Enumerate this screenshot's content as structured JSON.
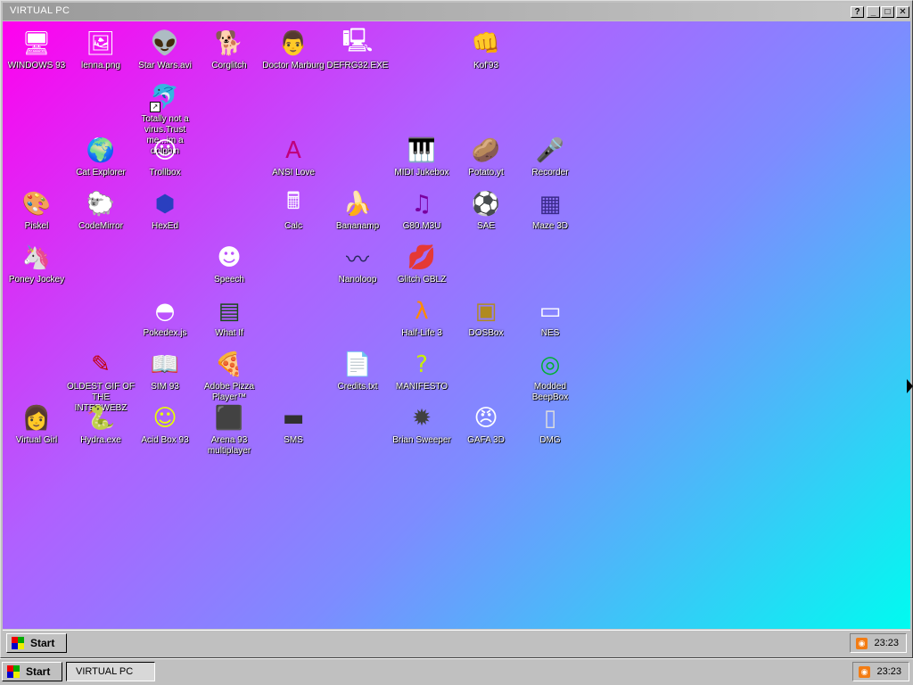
{
  "window": {
    "title": "VIRTUAL PC",
    "help_label": "?",
    "minimize_label": "_",
    "maximize_label": "□",
    "close_label": "✕"
  },
  "desktop": {
    "icons": [
      {
        "label": "WINDOWS 93",
        "icon": "computer-icon",
        "col": 0,
        "row": 0
      },
      {
        "label": "lenna.png",
        "icon": "image-file-icon",
        "col": 1,
        "row": 0
      },
      {
        "label": "Star Wars.avi",
        "icon": "yoda-icon",
        "col": 2,
        "row": 0
      },
      {
        "label": "Corglitch",
        "icon": "corgi-icon",
        "col": 3,
        "row": 0
      },
      {
        "label": "Doctor Marburg",
        "icon": "doctor-icon",
        "col": 4,
        "row": 0
      },
      {
        "label": "DEFRG32.EXE",
        "icon": "monitor-face-icon",
        "col": 5,
        "row": 0
      },
      {
        "label": "Kof'93",
        "icon": "fighter-icon",
        "col": 7,
        "row": 0
      },
      {
        "label": "Totally not a virus.Trust me...im a dolphin",
        "icon": "dolphin-icon",
        "col": 2,
        "row": 1,
        "shortcut": true
      },
      {
        "label": "Cat Explorer",
        "icon": "globe-cat-icon",
        "col": 1,
        "row": 2
      },
      {
        "label": "Trollbox",
        "icon": "trollbox-icon",
        "col": 2,
        "row": 2
      },
      {
        "label": "ANSI Love",
        "icon": "ansi-file-icon",
        "col": 4,
        "row": 2
      },
      {
        "label": "MIDI Jukebox",
        "icon": "piano-icon",
        "col": 6,
        "row": 2
      },
      {
        "label": "Potato.yt",
        "icon": "potato-icon",
        "col": 7,
        "row": 2
      },
      {
        "label": "Recorder",
        "icon": "microphone-icon",
        "col": 8,
        "row": 2
      },
      {
        "label": "Piskel",
        "icon": "palette-icon",
        "col": 0,
        "row": 3
      },
      {
        "label": "CodeMirror",
        "icon": "codemirror-icon",
        "col": 1,
        "row": 3
      },
      {
        "label": "HexEd",
        "icon": "hexagon-icon",
        "col": 2,
        "row": 3
      },
      {
        "label": "Calc",
        "icon": "calculator-icon",
        "col": 4,
        "row": 3
      },
      {
        "label": "Bananamp",
        "icon": "banana-icon",
        "col": 5,
        "row": 3
      },
      {
        "label": "G80.M3U",
        "icon": "audio-file-icon",
        "col": 6,
        "row": 3
      },
      {
        "label": "SAE",
        "icon": "amiga-ball-icon",
        "col": 7,
        "row": 3
      },
      {
        "label": "Maze 3D",
        "icon": "maze-icon",
        "col": 8,
        "row": 3
      },
      {
        "label": "Poney Jockey",
        "icon": "pony-icon",
        "col": 0,
        "row": 4
      },
      {
        "label": "Speech",
        "icon": "speech-face-icon",
        "col": 3,
        "row": 4
      },
      {
        "label": "Nanoloop",
        "icon": "waveform-icon",
        "col": 5,
        "row": 4
      },
      {
        "label": "Glitch GBLZ",
        "icon": "lips-icon",
        "col": 6,
        "row": 4
      },
      {
        "label": "Pokedex.js",
        "icon": "pokeball-icon",
        "col": 2,
        "row": 5
      },
      {
        "label": "What If",
        "icon": "terminal-icon",
        "col": 3,
        "row": 5
      },
      {
        "label": "Half-Life 3",
        "icon": "half-life-icon",
        "col": 6,
        "row": 5
      },
      {
        "label": "DOSBox",
        "icon": "dosbox-icon",
        "col": 7,
        "row": 5
      },
      {
        "label": "NES",
        "icon": "nes-console-icon",
        "col": 8,
        "row": 5
      },
      {
        "label": "OLDEST GIF OF THE INTERWEBZ",
        "icon": "gif-file-icon",
        "col": 1,
        "row": 6
      },
      {
        "label": "SIM 93",
        "icon": "book-icon",
        "col": 2,
        "row": 6
      },
      {
        "label": "Adobe Pizza Player™",
        "icon": "pizza-icon",
        "col": 3,
        "row": 6
      },
      {
        "label": "Credits.txt",
        "icon": "text-file-icon",
        "col": 5,
        "row": 6
      },
      {
        "label": "MANIFESTO",
        "icon": "question-mark-icon",
        "col": 6,
        "row": 6
      },
      {
        "label": "Modded BeepBox",
        "icon": "beepbox-icon",
        "col": 8,
        "row": 6
      },
      {
        "label": "Virtual Girl",
        "icon": "girl-face-icon",
        "col": 0,
        "row": 7
      },
      {
        "label": "Hydra.exe",
        "icon": "hydra-icon",
        "col": 1,
        "row": 7
      },
      {
        "label": "Acid Box 93",
        "icon": "smiley-icon",
        "col": 2,
        "row": 7
      },
      {
        "label": "Arena 93 multiplayer",
        "icon": "cube-icon",
        "col": 3,
        "row": 7
      },
      {
        "label": "SMS",
        "icon": "sms-console-icon",
        "col": 4,
        "row": 7
      },
      {
        "label": "Brian Sweeper",
        "icon": "mine-icon",
        "col": 6,
        "row": 7
      },
      {
        "label": "GAFA 3D",
        "icon": "doom-face-icon",
        "col": 7,
        "row": 7
      },
      {
        "label": "DMG",
        "icon": "gameboy-icon",
        "col": 8,
        "row": 7
      }
    ]
  },
  "inner_taskbar": {
    "start_label": "Start",
    "clock": "23:23",
    "tray_icon": "rss-icon"
  },
  "outer_taskbar": {
    "start_label": "Start",
    "task_label": "VIRTUAL PC",
    "clock": "23:23",
    "tray_icon": "rss-icon"
  }
}
